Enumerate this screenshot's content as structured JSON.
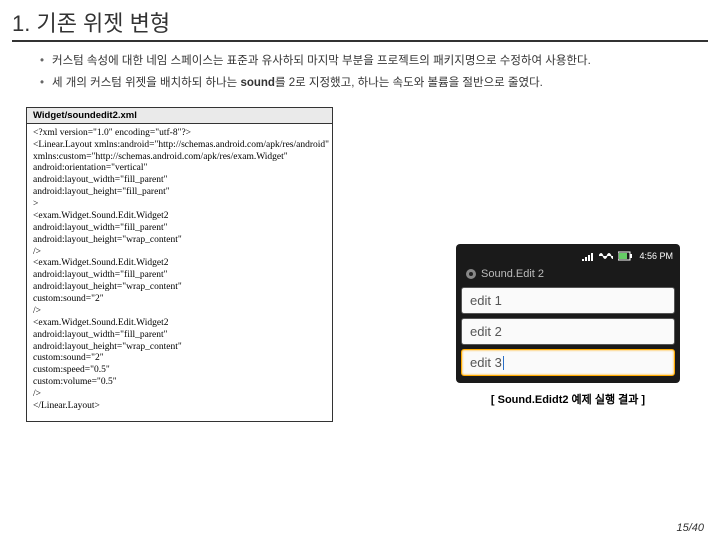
{
  "title": "1. 기존 위젯 변형",
  "bullets": [
    "커스텀 속성에 대한 네임 스페이스는 표준과 유사하되 마지막 부분을 프로젝트의 패키지명으로 수정하여 사용한다.",
    "세 개의 커스텀 위젯을 배치하되 하나는 sound를 2로 지정했고, 하나는 속도와 볼륨을 절반으로 줄였다."
  ],
  "boldWord": "sound",
  "code": {
    "file": "Widget/soundedit2.xml",
    "body": "<?xml version=\"1.0\" encoding=\"utf-8\"?>\n<Linear.Layout xmlns:android=\"http://schemas.android.com/apk/res/android\"\nxmlns:custom=\"http://schemas.android.com/apk/res/exam.Widget\"\nandroid:orientation=\"vertical\"\nandroid:layout_width=\"fill_parent\"\nandroid:layout_height=\"fill_parent\"\n>\n<exam.Widget.Sound.Edit.Widget2\nandroid:layout_width=\"fill_parent\"\nandroid:layout_height=\"wrap_content\"\n/>\n<exam.Widget.Sound.Edit.Widget2\nandroid:layout_width=\"fill_parent\"\nandroid:layout_height=\"wrap_content\"\ncustom:sound=\"2\"\n/>\n<exam.Widget.Sound.Edit.Widget2\nandroid:layout_width=\"fill_parent\"\nandroid:layout_height=\"wrap_content\"\ncustom:sound=\"2\"\ncustom:speed=\"0.5\"\ncustom:volume=\"0.5\"\n/>\n</Linear.Layout>"
  },
  "phone": {
    "time": "4:56 PM",
    "appTitle": "Sound.Edit 2",
    "rows": [
      "edit 1",
      "edit 2",
      "edit 3"
    ]
  },
  "caption": "[ Sound.Edidt2 예제 실행 결과 ]",
  "page": "15/40"
}
